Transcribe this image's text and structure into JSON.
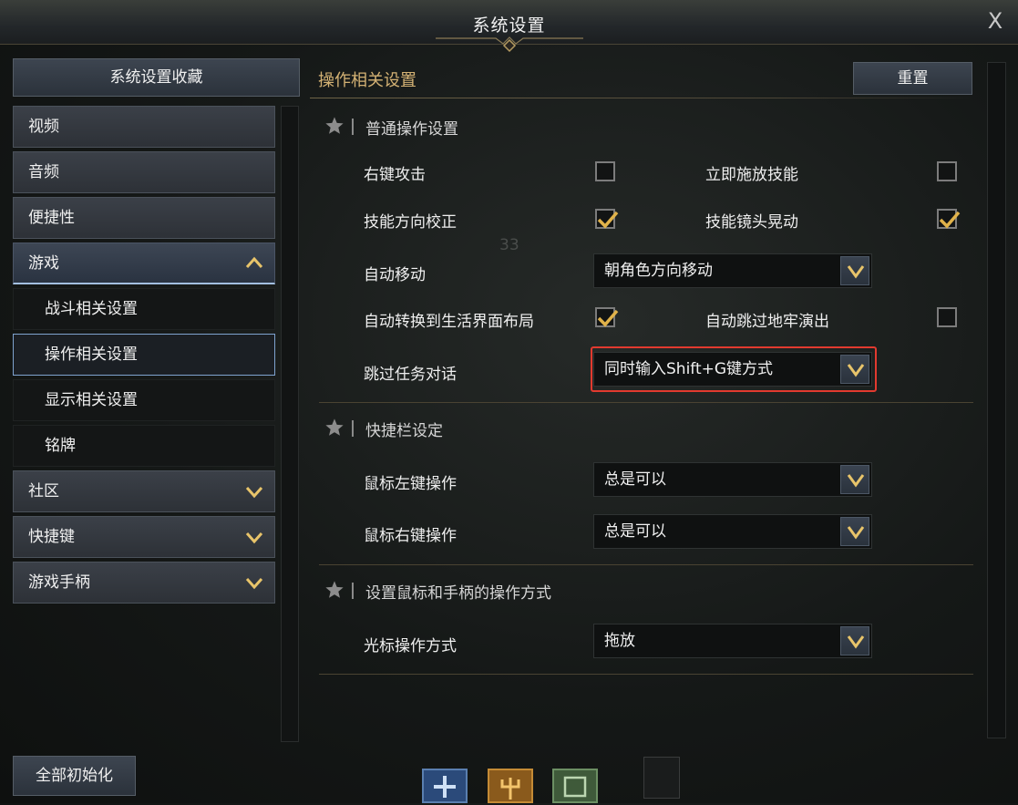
{
  "window": {
    "title": "系统设置",
    "close_label": "X"
  },
  "sidebar": {
    "favorites_label": "系统设置收藏",
    "items": [
      {
        "label": "视频",
        "kind": "top"
      },
      {
        "label": "音频",
        "kind": "top"
      },
      {
        "label": "便捷性",
        "kind": "top"
      },
      {
        "label": "游戏",
        "kind": "top-expanded"
      },
      {
        "label": "战斗相关设置",
        "kind": "sub"
      },
      {
        "label": "操作相关设置",
        "kind": "sub-selected"
      },
      {
        "label": "显示相关设置",
        "kind": "sub"
      },
      {
        "label": "铭牌",
        "kind": "sub"
      },
      {
        "label": "社区",
        "kind": "top-collapsed"
      },
      {
        "label": "快捷键",
        "kind": "top-collapsed"
      },
      {
        "label": "游戏手柄",
        "kind": "top-collapsed"
      }
    ],
    "reset_all_label": "全部初始化"
  },
  "main": {
    "section_title": "操作相关设置",
    "reset_label": "重置",
    "groups": [
      {
        "title": "普通操作设置",
        "rows": [
          {
            "left_label": "右键攻击",
            "left_checked": false,
            "right_label": "立即施放技能",
            "right_checked": false
          },
          {
            "left_label": "技能方向校正",
            "left_checked": true,
            "right_label": "技能镜头晃动",
            "right_checked": true
          },
          {
            "label": "自动移动",
            "dropdown_value": "朝角色方向移动"
          },
          {
            "left_label": "自动转换到生活界面布局",
            "left_checked": true,
            "right_label": "自动跳过地牢演出",
            "right_checked": false
          },
          {
            "label": "跳过任务对话",
            "dropdown_value": "同时输入Shift+G键方式",
            "highlighted": true
          }
        ]
      },
      {
        "title": "快捷栏设定",
        "rows": [
          {
            "label": "鼠标左键操作",
            "dropdown_value": "总是可以"
          },
          {
            "label": "鼠标右键操作",
            "dropdown_value": "总是可以"
          }
        ]
      },
      {
        "title": "设置鼠标和手柄的操作方式",
        "rows": [
          {
            "label": "光标操作方式",
            "dropdown_value": "拖放"
          }
        ]
      }
    ],
    "background_number": "33"
  },
  "colors": {
    "accent_gold": "#d4b274",
    "check_gold": "#e0b24a",
    "selection_blue": "#7fa3cf",
    "highlight_red": "#e23a2f"
  }
}
